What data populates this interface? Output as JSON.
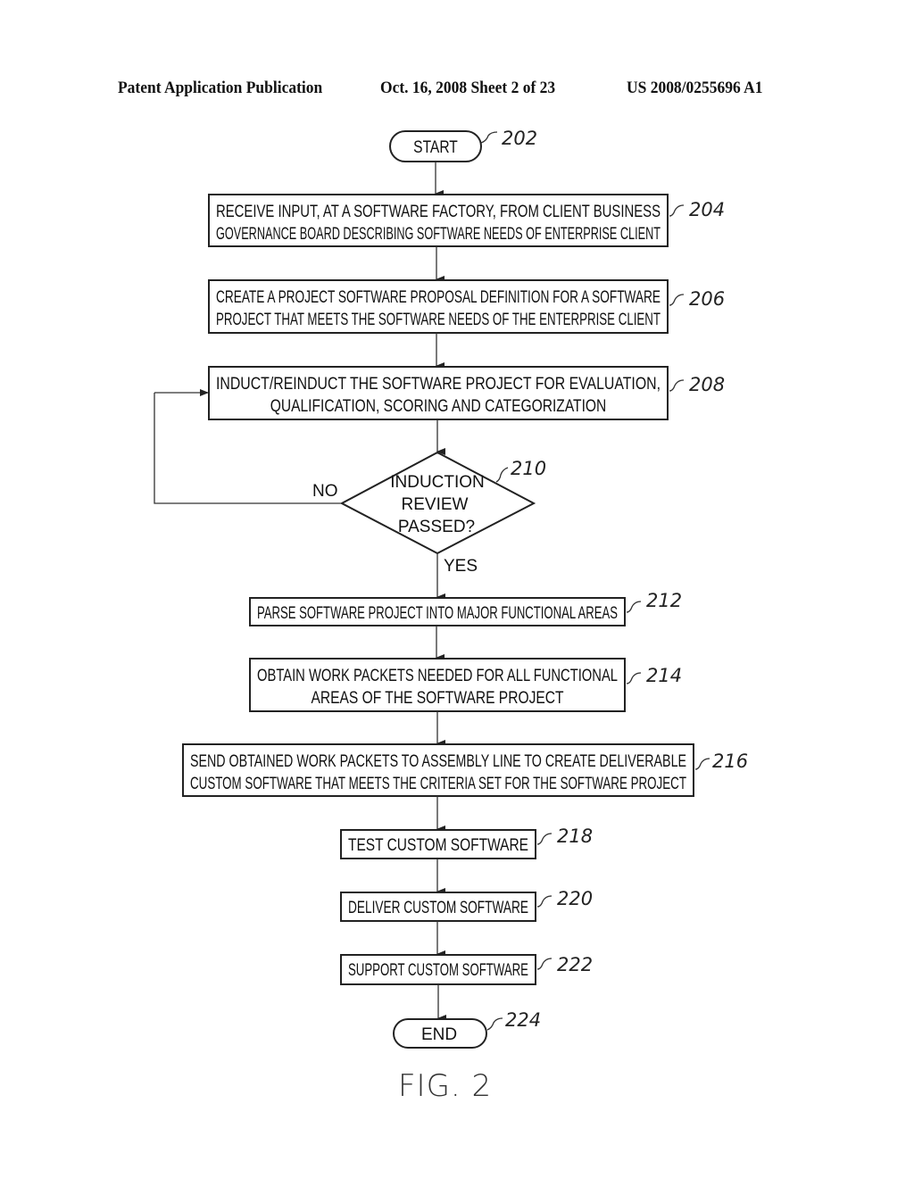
{
  "header": {
    "publication": "Patent Application Publication",
    "date_sheet": "Oct. 16, 2008  Sheet 2 of 23",
    "patent_number": "US 2008/0255696 A1"
  },
  "figure_label": "FIG. 2",
  "flowchart": {
    "start": {
      "ref": "202",
      "label": "START"
    },
    "steps": [
      {
        "ref": "204",
        "lines": [
          "RECEIVE INPUT, AT A SOFTWARE FACTORY, FROM CLIENT BUSINESS",
          "GOVERNANCE BOARD DESCRIBING SOFTWARE NEEDS OF ENTERPRISE CLIENT"
        ]
      },
      {
        "ref": "206",
        "lines": [
          "CREATE A PROJECT SOFTWARE PROPOSAL DEFINITION FOR A SOFTWARE",
          "PROJECT THAT MEETS THE SOFTWARE NEEDS OF THE ENTERPRISE CLIENT"
        ]
      },
      {
        "ref": "208",
        "lines": [
          "INDUCT/REINDUCT THE SOFTWARE PROJECT FOR EVALUATION,",
          "QUALIFICATION, SCORING AND CATEGORIZATION"
        ]
      }
    ],
    "decision": {
      "ref": "210",
      "lines": [
        "INDUCTION",
        "REVIEW",
        "PASSED?"
      ],
      "no_label": "NO",
      "yes_label": "YES"
    },
    "steps_after": [
      {
        "ref": "212",
        "lines": [
          "PARSE SOFTWARE PROJECT INTO MAJOR FUNCTIONAL AREAS"
        ]
      },
      {
        "ref": "214",
        "lines": [
          "OBTAIN WORK PACKETS NEEDED FOR ALL FUNCTIONAL",
          "AREAS OF THE SOFTWARE PROJECT"
        ]
      },
      {
        "ref": "216",
        "lines": [
          "SEND OBTAINED WORK PACKETS TO ASSEMBLY LINE TO CREATE DELIVERABLE",
          "CUSTOM SOFTWARE THAT MEETS THE CRITERIA SET FOR THE SOFTWARE PROJECT"
        ]
      },
      {
        "ref": "218",
        "lines": [
          "TEST CUSTOM SOFTWARE"
        ]
      },
      {
        "ref": "220",
        "lines": [
          "DELIVER CUSTOM SOFTWARE"
        ]
      },
      {
        "ref": "222",
        "lines": [
          "SUPPORT CUSTOM SOFTWARE"
        ]
      }
    ],
    "end": {
      "ref": "224",
      "label": "END"
    }
  }
}
